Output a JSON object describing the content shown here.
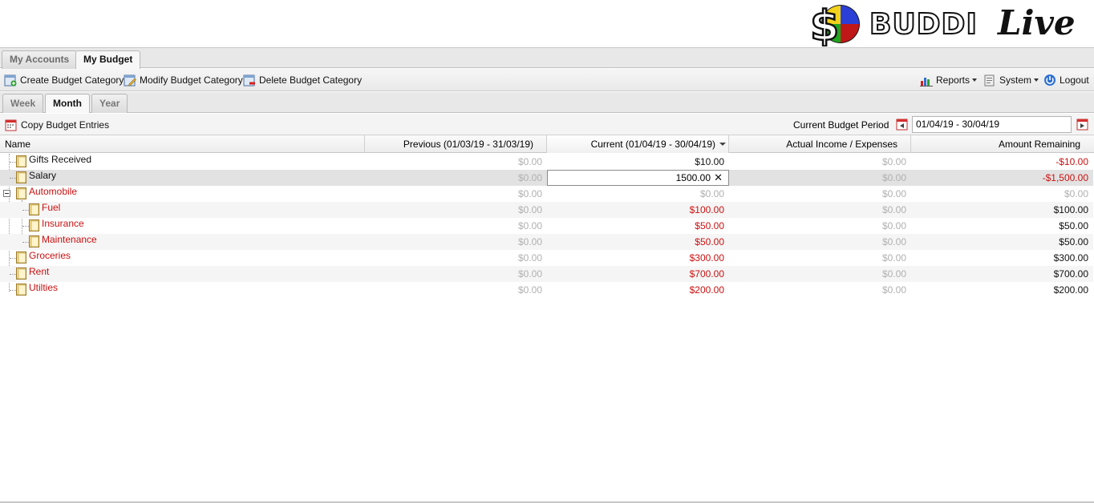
{
  "app": {
    "logo_word": "BUDDI",
    "logo_live": "Live"
  },
  "main_tabs": [
    {
      "label": "My Accounts",
      "active": false
    },
    {
      "label": "My Budget",
      "active": true
    }
  ],
  "toolbar": {
    "create_label": "Create Budget Category",
    "modify_label": "Modify Budget Category",
    "delete_label": "Delete Budget Category",
    "reports_label": "Reports",
    "system_label": "System",
    "logout_label": "Logout"
  },
  "period_tabs": [
    {
      "label": "Week",
      "active": false
    },
    {
      "label": "Month",
      "active": true
    },
    {
      "label": "Year",
      "active": false
    }
  ],
  "subbar": {
    "copy_label": "Copy Budget Entries",
    "period_label": "Current Budget Period",
    "period_value": "01/04/19 - 30/04/19"
  },
  "grid": {
    "columns": {
      "name": "Name",
      "previous": "Previous (01/03/19 - 31/03/19)",
      "current": "Current (01/04/19 - 30/04/19)",
      "actual": "Actual Income / Expenses",
      "remaining": "Amount Remaining"
    },
    "editing_value": "1500.00",
    "rows": [
      {
        "name": "Gifts Received",
        "previous": "$0.00",
        "current": "$10.00",
        "actual": "$0.00",
        "remaining": "-$10.00",
        "income": true
      },
      {
        "name": "Salary",
        "previous": "$0.00",
        "current": "1500.00",
        "actual": "$0.00",
        "remaining": "-$1,500.00",
        "income": true
      },
      {
        "name": "Automobile",
        "previous": "$0.00",
        "current": "$0.00",
        "actual": "$0.00",
        "remaining": "$0.00",
        "income": false
      },
      {
        "name": "Fuel",
        "previous": "$0.00",
        "current": "$100.00",
        "actual": "$0.00",
        "remaining": "$100.00",
        "income": false
      },
      {
        "name": "Insurance",
        "previous": "$0.00",
        "current": "$50.00",
        "actual": "$0.00",
        "remaining": "$50.00",
        "income": false
      },
      {
        "name": "Maintenance",
        "previous": "$0.00",
        "current": "$50.00",
        "actual": "$0.00",
        "remaining": "$50.00",
        "income": false
      },
      {
        "name": "Groceries",
        "previous": "$0.00",
        "current": "$300.00",
        "actual": "$0.00",
        "remaining": "$300.00",
        "income": false
      },
      {
        "name": "Rent",
        "previous": "$0.00",
        "current": "$700.00",
        "actual": "$0.00",
        "remaining": "$700.00",
        "income": false
      },
      {
        "name": "Utilties",
        "previous": "$0.00",
        "current": "$200.00",
        "actual": "$0.00",
        "remaining": "$200.00",
        "income": false
      }
    ]
  },
  "colors": {
    "expense_text": "#cc1111",
    "muted_text": "#b0b0b0",
    "tab_bg": "#e8e8e8"
  }
}
